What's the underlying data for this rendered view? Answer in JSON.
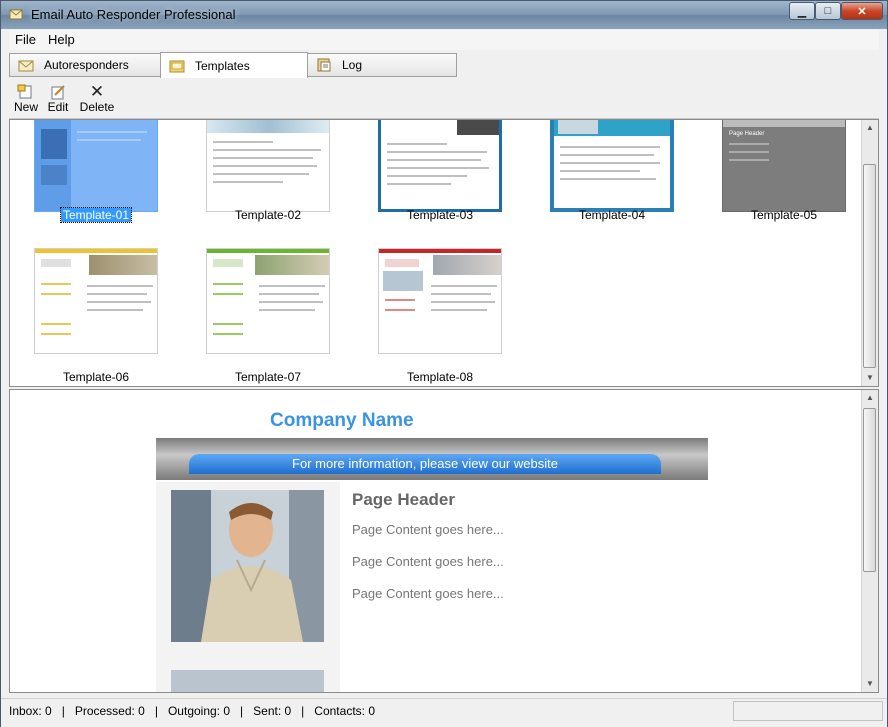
{
  "window": {
    "title": "Email Auto Responder Professional",
    "minimize": "▁",
    "maximize": "□",
    "close": "✕"
  },
  "menu": {
    "file": "File",
    "help": "Help"
  },
  "tabs": [
    {
      "label": "Autoresponders",
      "icon": "envelope-icon"
    },
    {
      "label": "Templates",
      "icon": "template-folder-icon"
    },
    {
      "label": "Log",
      "icon": "log-book-icon"
    }
  ],
  "toolbar": {
    "new_label": "New",
    "edit_label": "Edit",
    "delete_label": "Delete",
    "delete_glyph": "✕"
  },
  "templates": [
    {
      "label": "Template-01",
      "selected": true
    },
    {
      "label": "Template-02",
      "selected": false
    },
    {
      "label": "Template-03",
      "selected": false
    },
    {
      "label": "Template-04",
      "selected": false
    },
    {
      "label": "Template-05",
      "selected": false
    },
    {
      "label": "Template-06",
      "selected": false
    },
    {
      "label": "Template-07",
      "selected": false
    },
    {
      "label": "Template-08",
      "selected": false
    }
  ],
  "preview": {
    "company_name": "Company Name",
    "banner_text": "For more information, please view our website",
    "page_header": "Page Header",
    "content_lines": [
      "Page Content goes here...",
      "Page Content goes here...",
      "Page Content goes here..."
    ]
  },
  "status": {
    "text": "Inbox: 0   |   Processed: 0   |   Outgoing: 0   |   Sent: 0   |   Contacts: 0"
  },
  "colors": {
    "accent": "#3b93e3",
    "selection": "#3399ff",
    "banner": "#1e6fcf"
  }
}
